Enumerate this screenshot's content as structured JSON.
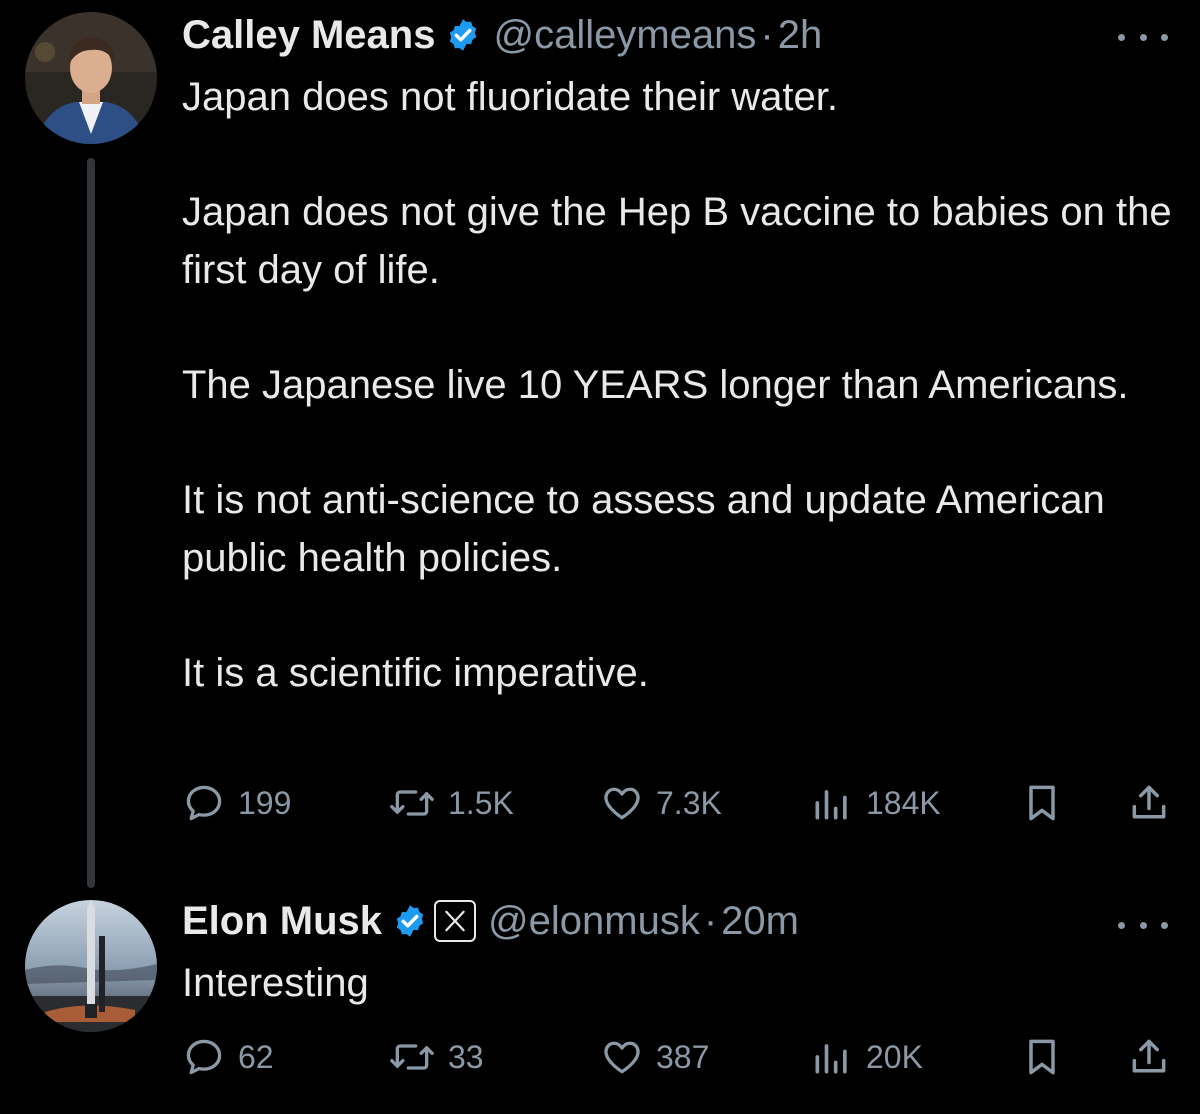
{
  "tweets": [
    {
      "display_name": "Calley Means",
      "handle": "@calleymeans",
      "separator": "·",
      "timestamp": "2h",
      "paragraphs": [
        "Japan does not fluoridate their water.",
        "Japan does not give the Hep B vaccine to babies on the first day of life.",
        "The Japanese live 10 YEARS longer than Americans.",
        "It is not anti-science to assess and update American public health policies.",
        "It is a scientific imperative."
      ],
      "replies": "199",
      "reposts": "1.5K",
      "likes": "7.3K",
      "views": "184K"
    },
    {
      "display_name": "Elon Musk",
      "handle": "@elonmusk",
      "separator": "·",
      "timestamp": "20m",
      "paragraphs": [
        "Interesting"
      ],
      "replies": "62",
      "reposts": "33",
      "likes": "387",
      "views": "20K"
    }
  ],
  "colors": {
    "background": "#000000",
    "text_primary": "#e7e9ea",
    "text_secondary": "#8b98a5",
    "verified_blue": "#1d9bf0",
    "thread_line": "#333639"
  },
  "icons": {
    "reply": "speech-bubble-icon",
    "repost": "repost-arrows-icon",
    "like": "heart-icon",
    "views": "bar-chart-icon",
    "bookmark": "bookmark-icon",
    "share": "share-upload-icon",
    "verified": "verified-badge-icon",
    "affiliate": "x-logo-icon",
    "more": "ellipsis-icon"
  }
}
